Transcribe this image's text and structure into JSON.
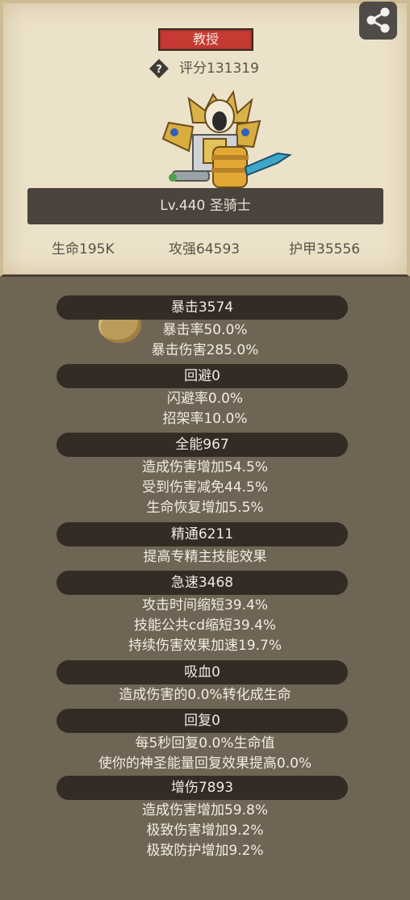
{
  "header": {
    "badge_label": "教授",
    "score_text": "评分131319"
  },
  "character": {
    "name": "Lv.440 圣骑士"
  },
  "stats": {
    "hp": "生命195K",
    "attack": "攻强64593",
    "armor": "护甲35556"
  },
  "sections": [
    {
      "title": "暴击3574",
      "lines": [
        "暴击率50.0%",
        "暴击伤害285.0%"
      ]
    },
    {
      "title": "回避0",
      "lines": [
        "闪避率0.0%",
        "招架率10.0%"
      ]
    },
    {
      "title": "全能967",
      "lines": [
        "造成伤害增加54.5%",
        "受到伤害减免44.5%",
        "生命恢复增加5.5%"
      ]
    },
    {
      "title": "精通6211",
      "lines": [
        "提高专精主技能效果"
      ]
    },
    {
      "title": "急速3468",
      "lines": [
        "攻击时间缩短39.4%",
        "技能公共cd缩短39.4%",
        "持续伤害效果加速19.7%"
      ]
    },
    {
      "title": "吸血0",
      "lines": [
        "造成伤害的0.0%转化成生命"
      ]
    },
    {
      "title": "回复0",
      "lines": [
        "每5秒回复0.0%生命值",
        "使你的神圣能量回复效果提高0.0%"
      ]
    },
    {
      "title": "增伤7893",
      "lines": [
        "造成伤害增加59.8%",
        "极致伤害增加9.2%",
        "极致防护增加9.2%"
      ]
    }
  ],
  "icons": {
    "share": "share-icon",
    "help": "question-icon",
    "coin": "coin-icon"
  },
  "colors": {
    "badge": "#c73a34",
    "parchment": "#ece2c9",
    "background": "#6f6555",
    "section_header": "#332c25"
  }
}
